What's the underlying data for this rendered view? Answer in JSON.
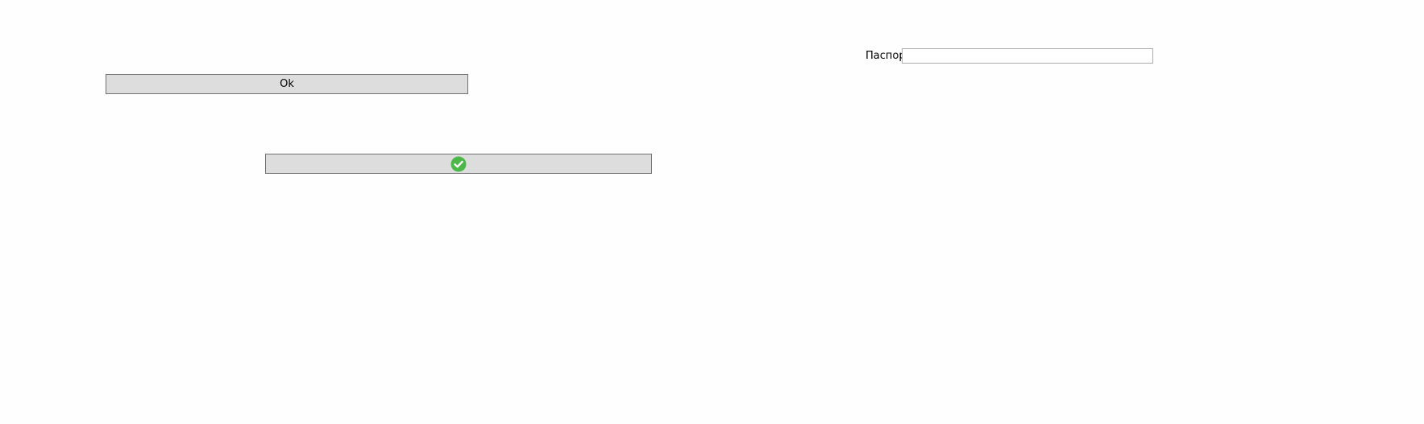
{
  "form": {
    "passport_label": "Паспорт",
    "passport_value": "",
    "ok_label": "Ok",
    "confirm_icon": "check-circle-icon",
    "confirm_icon_color": "#4cb848"
  }
}
